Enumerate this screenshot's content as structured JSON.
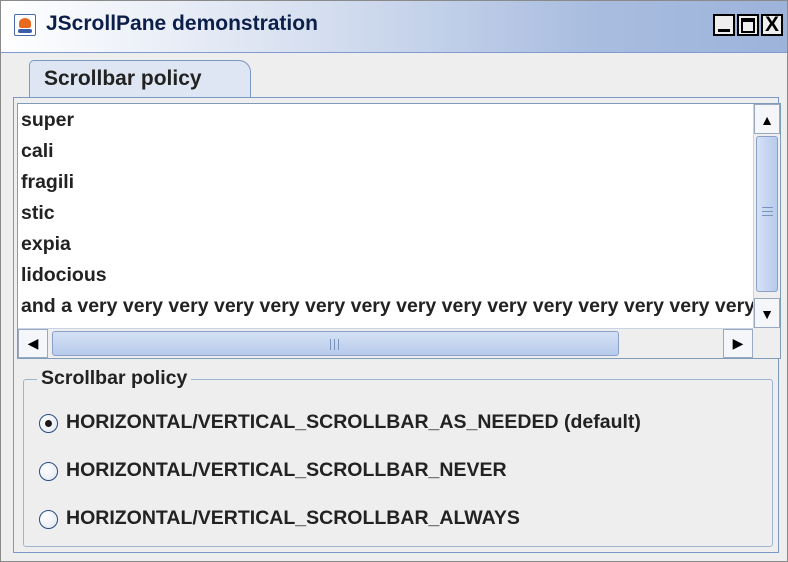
{
  "window": {
    "title": "JScrollPane demonstration",
    "icon": "java-cup-icon",
    "controls": {
      "minimize": "_",
      "maximize": "□",
      "close": "X"
    }
  },
  "tabs": [
    {
      "label": "Scrollbar policy",
      "selected": true
    }
  ],
  "text_area": {
    "lines": [
      "super",
      "cali",
      "fragili",
      "stic",
      "expia",
      "lidocious",
      "and a very very very very very very very very very very very very very very very very very very very very very very long line"
    ]
  },
  "scrollbars": {
    "vertical": {
      "up_icon": "▲",
      "down_icon": "▼"
    },
    "horizontal": {
      "left_icon": "◀",
      "right_icon": "▶"
    }
  },
  "policy_group": {
    "legend": "Scrollbar policy",
    "options": [
      {
        "label": "HORIZONTAL/VERTICAL_SCROLLBAR_AS_NEEDED (default)",
        "selected": true
      },
      {
        "label": "HORIZONTAL/VERTICAL_SCROLLBAR_NEVER",
        "selected": false
      },
      {
        "label": "HORIZONTAL/VERTICAL_SCROLLBAR_ALWAYS",
        "selected": false
      }
    ]
  },
  "colors": {
    "selection_border": "#7b97c4",
    "thumb": "#b8cbec",
    "text": "#222222"
  }
}
